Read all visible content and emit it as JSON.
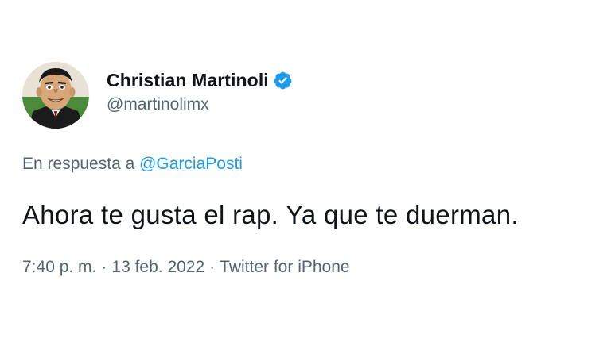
{
  "author": {
    "display_name": "Christian Martinoli",
    "handle": "@martinolimx",
    "verified": true,
    "verified_icon": "verified-badge-icon",
    "avatar_icon": "caricature-avatar"
  },
  "reply": {
    "prefix": "En respuesta a",
    "mention": "@GarciaPosti"
  },
  "tweet": {
    "text": "Ahora te gusta el rap. Ya que te duerman."
  },
  "meta": {
    "time": "7:40 p. m.",
    "date": "13 feb. 2022",
    "source": "Twitter for iPhone",
    "separator": "·"
  },
  "colors": {
    "text_primary": "#0f1419",
    "text_secondary": "#536471",
    "link": "#1d9bf0",
    "verified": "#1d9bf0"
  }
}
